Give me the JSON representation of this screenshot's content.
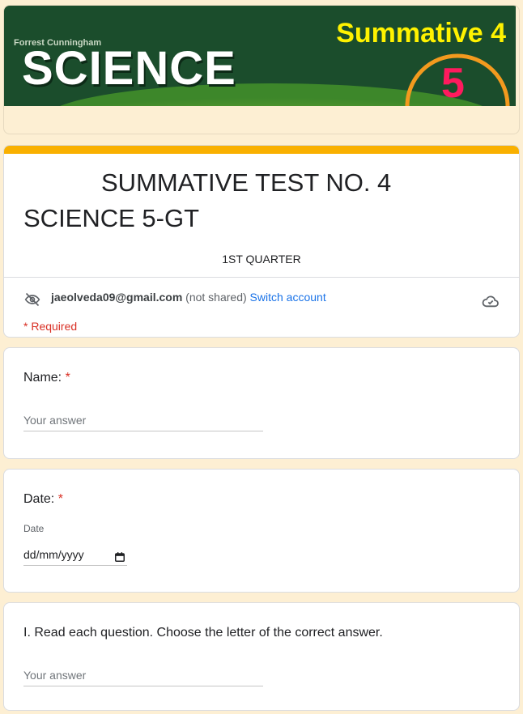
{
  "banner": {
    "brand": "Forrest Cunningham",
    "subject": "SCIENCE",
    "summative_label": "Summative 4",
    "grade": "5"
  },
  "header": {
    "title": "SUMMATIVE TEST NO. 4 SCIENCE 5-GT",
    "subtitle": "1ST QUARTER",
    "accent_color": "#f9b000",
    "account_email": "jaeolveda09@gmail.com",
    "not_shared": "(not shared)",
    "switch_account": "Switch account",
    "required_note": "* Required",
    "hidden_icon": "eye-off-icon",
    "saved_icon": "cloud-check-icon"
  },
  "questions": [
    {
      "title": "Name:",
      "required_mark": "*",
      "placeholder": "Your answer"
    },
    {
      "title": "Date:",
      "required_mark": "*",
      "field_label": "Date",
      "date_placeholder": "dd/mm/yyyy",
      "icon": "calendar-icon"
    },
    {
      "title": "I. Read each question. Choose the letter of the correct answer.",
      "placeholder": "Your answer"
    }
  ],
  "colors": {
    "page_background": "#fdefd3",
    "required": "#d93025",
    "link": "#1a73e8",
    "banner_green": "#1b4d2c",
    "summative_yellow": "#fff200",
    "grade_pink": "#ff1a5e"
  }
}
